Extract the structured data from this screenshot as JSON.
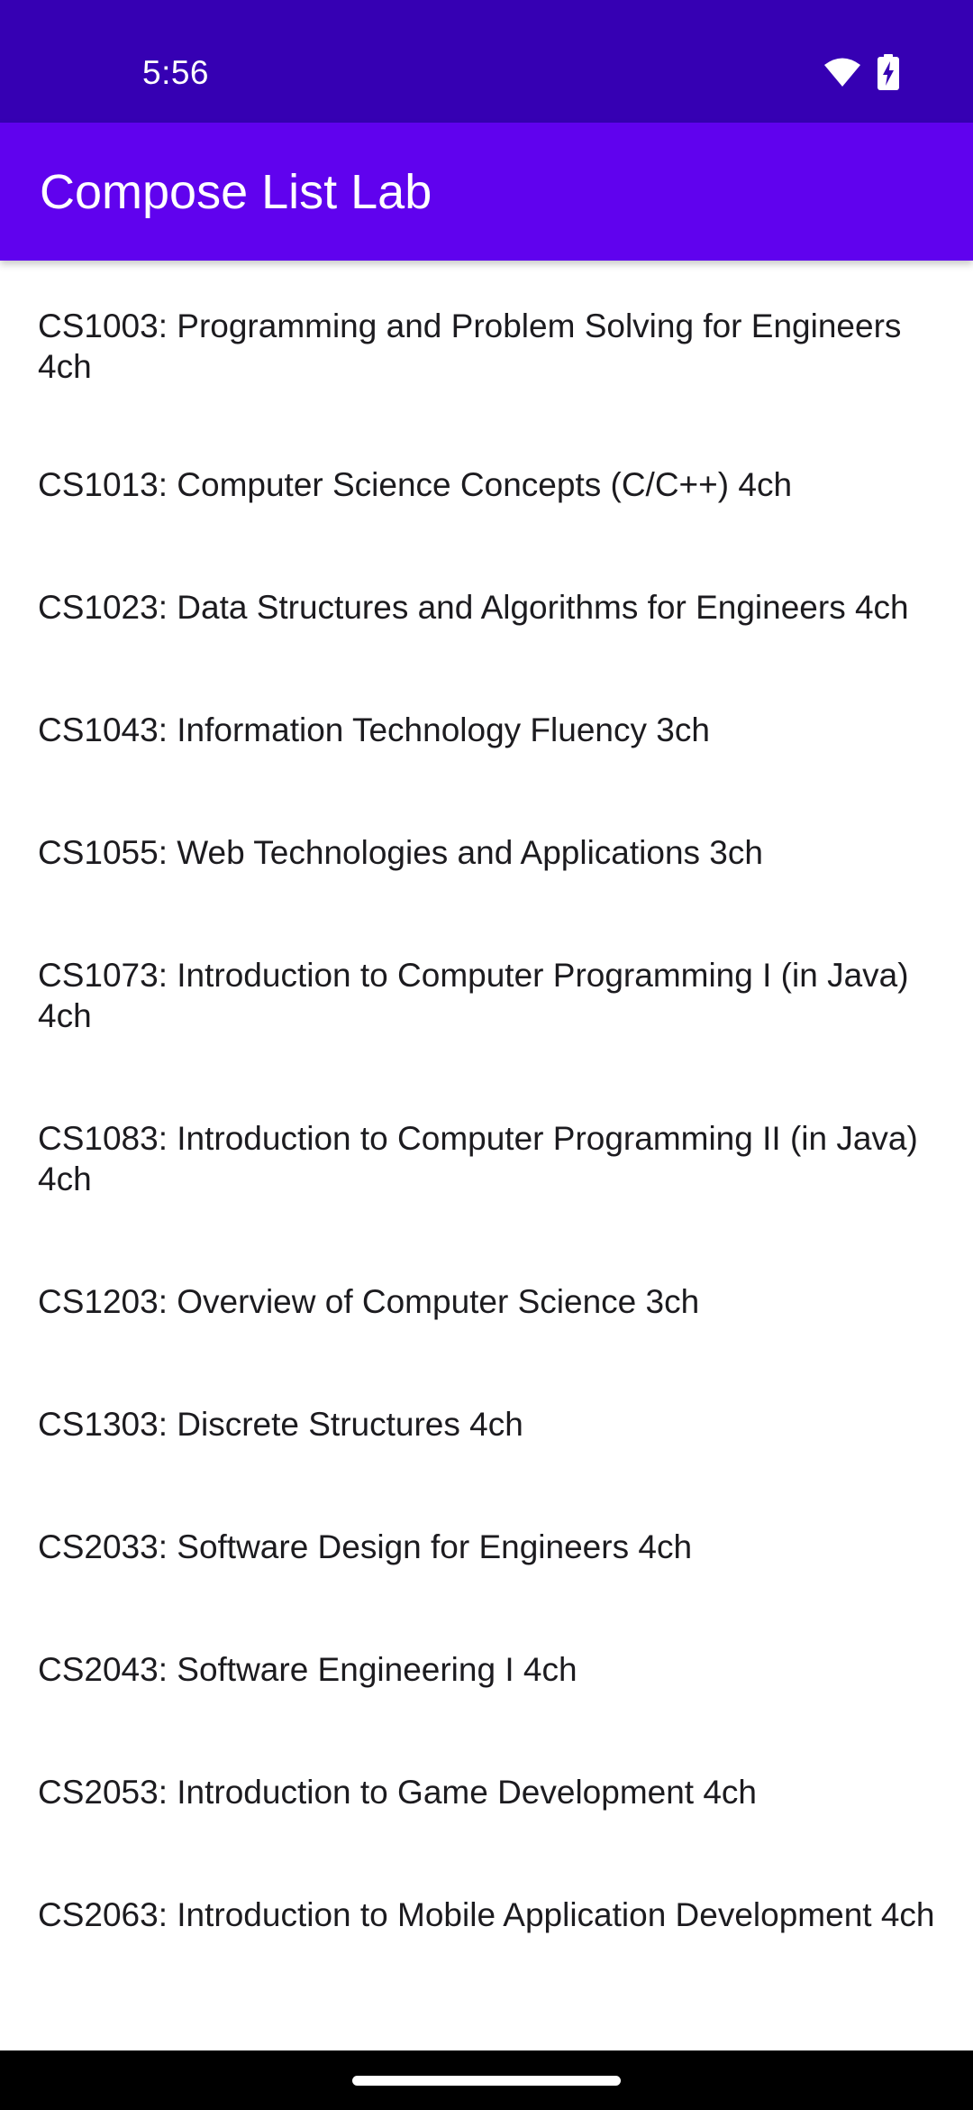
{
  "status_bar": {
    "time": "5:56",
    "icons": [
      "wifi-icon",
      "battery-charging-icon"
    ],
    "background": "#3600b3"
  },
  "app_bar": {
    "title": "Compose List Lab",
    "background": "#6002ee"
  },
  "courses": [
    {
      "label": "CS1003: Programming and Problem Solving for Engineers 4ch"
    },
    {
      "label": "CS1013: Computer Science Concepts (C/C++) 4ch"
    },
    {
      "label": "CS1023: Data Structures and Algorithms for Engineers 4ch"
    },
    {
      "label": "CS1043: Information Technology Fluency 3ch"
    },
    {
      "label": "CS1055: Web Technologies and Applications 3ch"
    },
    {
      "label": "CS1073: Introduction to Computer Programming I (in Java) 4ch"
    },
    {
      "label": "CS1083: Introduction to Computer Programming II (in Java) 4ch"
    },
    {
      "label": "CS1203: Overview of Computer Science 3ch"
    },
    {
      "label": "CS1303: Discrete Structures 4ch"
    },
    {
      "label": "CS2033: Software Design for Engineers 4ch"
    },
    {
      "label": "CS2043: Software Engineering I 4ch"
    },
    {
      "label": "CS2053: Introduction to Game Development 4ch"
    },
    {
      "label": "CS2063: Introduction to Mobile Application Development 4ch"
    }
  ]
}
